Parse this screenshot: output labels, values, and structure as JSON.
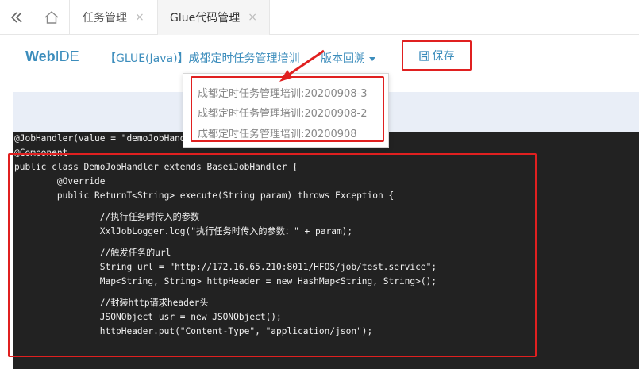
{
  "tabs": [
    {
      "label": "任务管理",
      "close": "×"
    },
    {
      "label": "Glue代码管理",
      "close": "×"
    }
  ],
  "header": {
    "brand_bold": "Web",
    "brand_light": "IDE",
    "glue_title": "【GLUE(Java)】成都定时任务管理培训",
    "version_label": "版本回溯",
    "save_label": "保存"
  },
  "version_menu": {
    "items": [
      "成都定时任务管理培训:20200908-3",
      "成都定时任务管理培训:20200908-2",
      "成都定时任务管理培训:20200908"
    ]
  },
  "code_lines": [
    "@JobHandler(value = \"demoJobHandler\")",
    "@Component",
    "public class DemoJobHandler extends BaseiJobHandler {",
    "        @Override",
    "        public ReturnT<String> execute(String param) throws Exception {",
    "",
    "                //执行任务时传入的参数",
    "                XxlJobLogger.log(\"执行任务时传入的参数：\" + param);",
    "",
    "                //触发任务的url",
    "                String url = \"http://172.16.65.210:8011/HFOS/job/test.service\";",
    "                Map<String, String> httpHeader = new HashMap<String, String>();",
    "",
    "                //封装http请求header头",
    "                JSONObject usr = new JSONObject();",
    "                httpHeader.put(\"Content-Type\", \"application/json\");"
  ],
  "colors": {
    "accent": "#3c8dbc",
    "highlight": "#e02020",
    "editor_bg": "#222222",
    "band": "#e9eef7"
  },
  "icons": [
    "double-chevron-left-icon",
    "home-icon",
    "close-icon",
    "save-icon",
    "caret-down-icon"
  ]
}
